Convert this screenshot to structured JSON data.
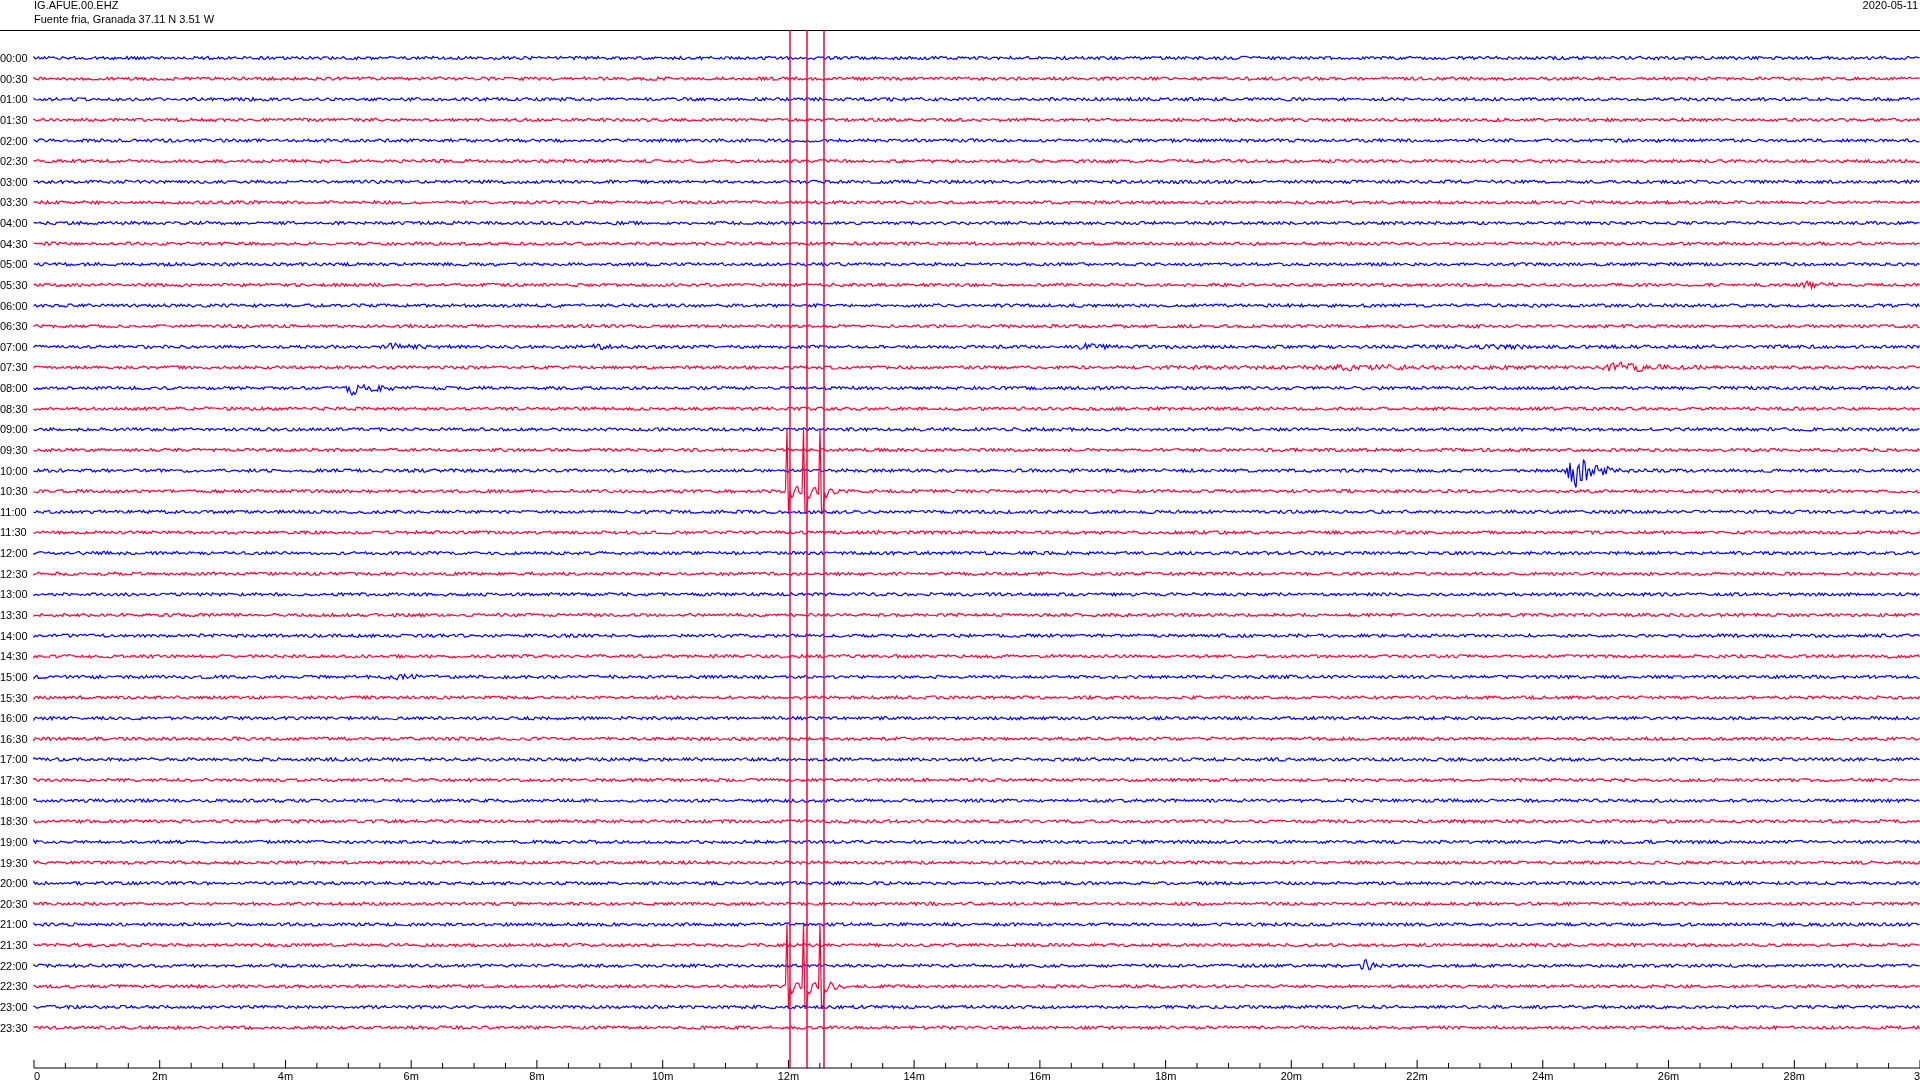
{
  "header": {
    "station": "IG.AFUE.00.EHZ",
    "location": "Fuente fria, Granada  37.11 N 3.51 W",
    "date": "2020-05-11"
  },
  "rows": [
    {
      "time": "00:00",
      "color": "#0000ff"
    },
    {
      "time": "00:30",
      "color": "#ff0033"
    },
    {
      "time": "01:00",
      "color": "#0000ff"
    },
    {
      "time": "01:30",
      "color": "#ff0033"
    },
    {
      "time": "02:00",
      "color": "#0000ff"
    },
    {
      "time": "02:30",
      "color": "#ff0033"
    },
    {
      "time": "03:00",
      "color": "#0000ff"
    },
    {
      "time": "03:30",
      "color": "#ff0033"
    },
    {
      "time": "04:00",
      "color": "#0000ff"
    },
    {
      "time": "04:30",
      "color": "#ff0033"
    },
    {
      "time": "05:00",
      "color": "#0000ff"
    },
    {
      "time": "05:30",
      "color": "#ff0033"
    },
    {
      "time": "06:00",
      "color": "#0000ff"
    },
    {
      "time": "06:30",
      "color": "#ff0033"
    },
    {
      "time": "07:00",
      "color": "#0000ff"
    },
    {
      "time": "07:30",
      "color": "#ff0033"
    },
    {
      "time": "08:00",
      "color": "#0000ff"
    },
    {
      "time": "08:30",
      "color": "#ff0033"
    },
    {
      "time": "09:00",
      "color": "#0000ff"
    },
    {
      "time": "09:30",
      "color": "#ff0033"
    },
    {
      "time": "10:00",
      "color": "#0000ff"
    },
    {
      "time": "10:30",
      "color": "#ff0033"
    },
    {
      "time": "11:00",
      "color": "#0000ff"
    },
    {
      "time": "11:30",
      "color": "#ff0033"
    },
    {
      "time": "12:00",
      "color": "#0000ff"
    },
    {
      "time": "12:30",
      "color": "#ff0033"
    },
    {
      "time": "13:00",
      "color": "#0000ff"
    },
    {
      "time": "13:30",
      "color": "#ff0033"
    },
    {
      "time": "14:00",
      "color": "#0000ff"
    },
    {
      "time": "14:30",
      "color": "#ff0033"
    },
    {
      "time": "15:00",
      "color": "#0000ff"
    },
    {
      "time": "15:30",
      "color": "#ff0033"
    },
    {
      "time": "16:00",
      "color": "#0000ff"
    },
    {
      "time": "16:30",
      "color": "#ff0033"
    },
    {
      "time": "17:00",
      "color": "#0000ff"
    },
    {
      "time": "17:30",
      "color": "#ff0033"
    },
    {
      "time": "18:00",
      "color": "#0000ff"
    },
    {
      "time": "18:30",
      "color": "#ff0033"
    },
    {
      "time": "19:00",
      "color": "#0000ff"
    },
    {
      "time": "19:30",
      "color": "#ff0033"
    },
    {
      "time": "20:00",
      "color": "#0000ff"
    },
    {
      "time": "20:30",
      "color": "#ff0033"
    },
    {
      "time": "21:00",
      "color": "#0000ff"
    },
    {
      "time": "21:30",
      "color": "#ff0033"
    },
    {
      "time": "22:00",
      "color": "#0000ff"
    },
    {
      "time": "22:30",
      "color": "#ff0033"
    },
    {
      "time": "23:00",
      "color": "#0000ff"
    },
    {
      "time": "23:30",
      "color": "#ff0033"
    }
  ],
  "x_axis": {
    "labels": [
      "0",
      "2m",
      "4m",
      "6m",
      "8m",
      "10m",
      "12m",
      "14m",
      "16m",
      "18m",
      "20m",
      "22m",
      "24m",
      "26m",
      "28m",
      "3"
    ]
  }
}
